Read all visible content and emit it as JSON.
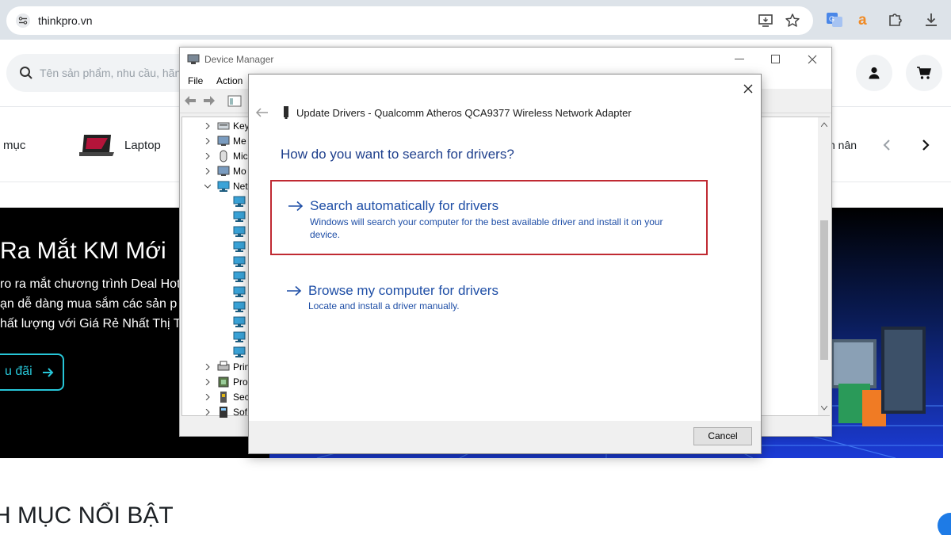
{
  "browser": {
    "url": "thinkpro.vn",
    "icons": [
      "site-settings-icon",
      "install-app-icon",
      "star-icon",
      "translate-extension-icon",
      "amazon-extension-icon",
      "extensions-puzzle-icon",
      "download-icon"
    ]
  },
  "website": {
    "search_placeholder": "Tên sản phẩm, nhu cầu, hãng",
    "categories": [
      "mục",
      "Laptop",
      "n nân"
    ],
    "hero": {
      "title": "Ra Mắt KM Mới",
      "lines": [
        "ro ra mắt chương trình Deal Hot",
        "ạn dễ dàng mua sắm các sản p",
        "hất lượng với Giá Rẻ Nhất Thị T"
      ],
      "button": "u đãi"
    },
    "featured_heading": "H MỤC NỔI BẬT"
  },
  "device_manager": {
    "title": "Device Manager",
    "menu": [
      "File",
      "Action"
    ],
    "tree": [
      {
        "label": "Key",
        "icon": "keyboard-icon",
        "expanded": false
      },
      {
        "label": "Me",
        "icon": "monitor-icon",
        "expanded": false
      },
      {
        "label": "Mic",
        "icon": "mouse-icon",
        "expanded": false
      },
      {
        "label": "Mo",
        "icon": "monitor-icon",
        "expanded": false
      },
      {
        "label": "Net",
        "icon": "network-adapter-icon",
        "expanded": true
      },
      {
        "label": "Prin",
        "icon": "printer-icon",
        "expanded": false
      },
      {
        "label": "Pro",
        "icon": "processor-icon",
        "expanded": false
      },
      {
        "label": "Sec",
        "icon": "security-device-icon",
        "expanded": false
      },
      {
        "label": "Sof",
        "icon": "software-device-icon",
        "expanded": false
      }
    ],
    "network_children_count": 11
  },
  "dialog": {
    "title": "Update Drivers - Qualcomm Atheros QCA9377 Wireless Network Adapter",
    "question": "How do you want to search for drivers?",
    "options": [
      {
        "title": "Search automatically for drivers",
        "description": "Windows will search your computer for the best available driver and install it on your device.",
        "highlighted": true
      },
      {
        "title": "Browse my computer for drivers",
        "description": "Locate and install a driver manually.",
        "highlighted": false
      }
    ],
    "cancel_label": "Cancel"
  },
  "colors": {
    "link_blue": "#1e4ea6",
    "heading_blue": "#1e3f8c",
    "highlight_red": "#c02a32",
    "hero_accent": "#27c6d8"
  }
}
